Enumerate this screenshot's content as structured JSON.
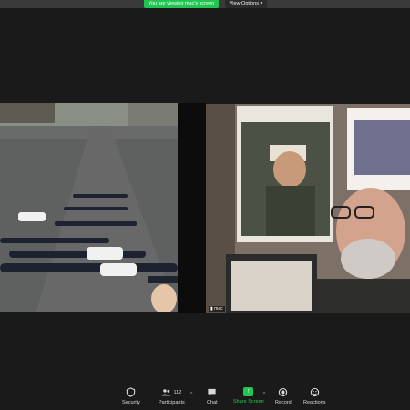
{
  "topbar": {
    "share_banner": "You are viewing mac's screen",
    "view_options": "View Options"
  },
  "tiles": {
    "right_name": "mac"
  },
  "toolbar": {
    "security": "Security",
    "participants": "Participants",
    "participants_count": "112",
    "chat": "Chat",
    "share_screen": "Share Screen",
    "record": "Record",
    "reactions": "Reactions"
  },
  "colors": {
    "share_green": "#23c552",
    "toolbar_bg": "#1a1a1a"
  }
}
